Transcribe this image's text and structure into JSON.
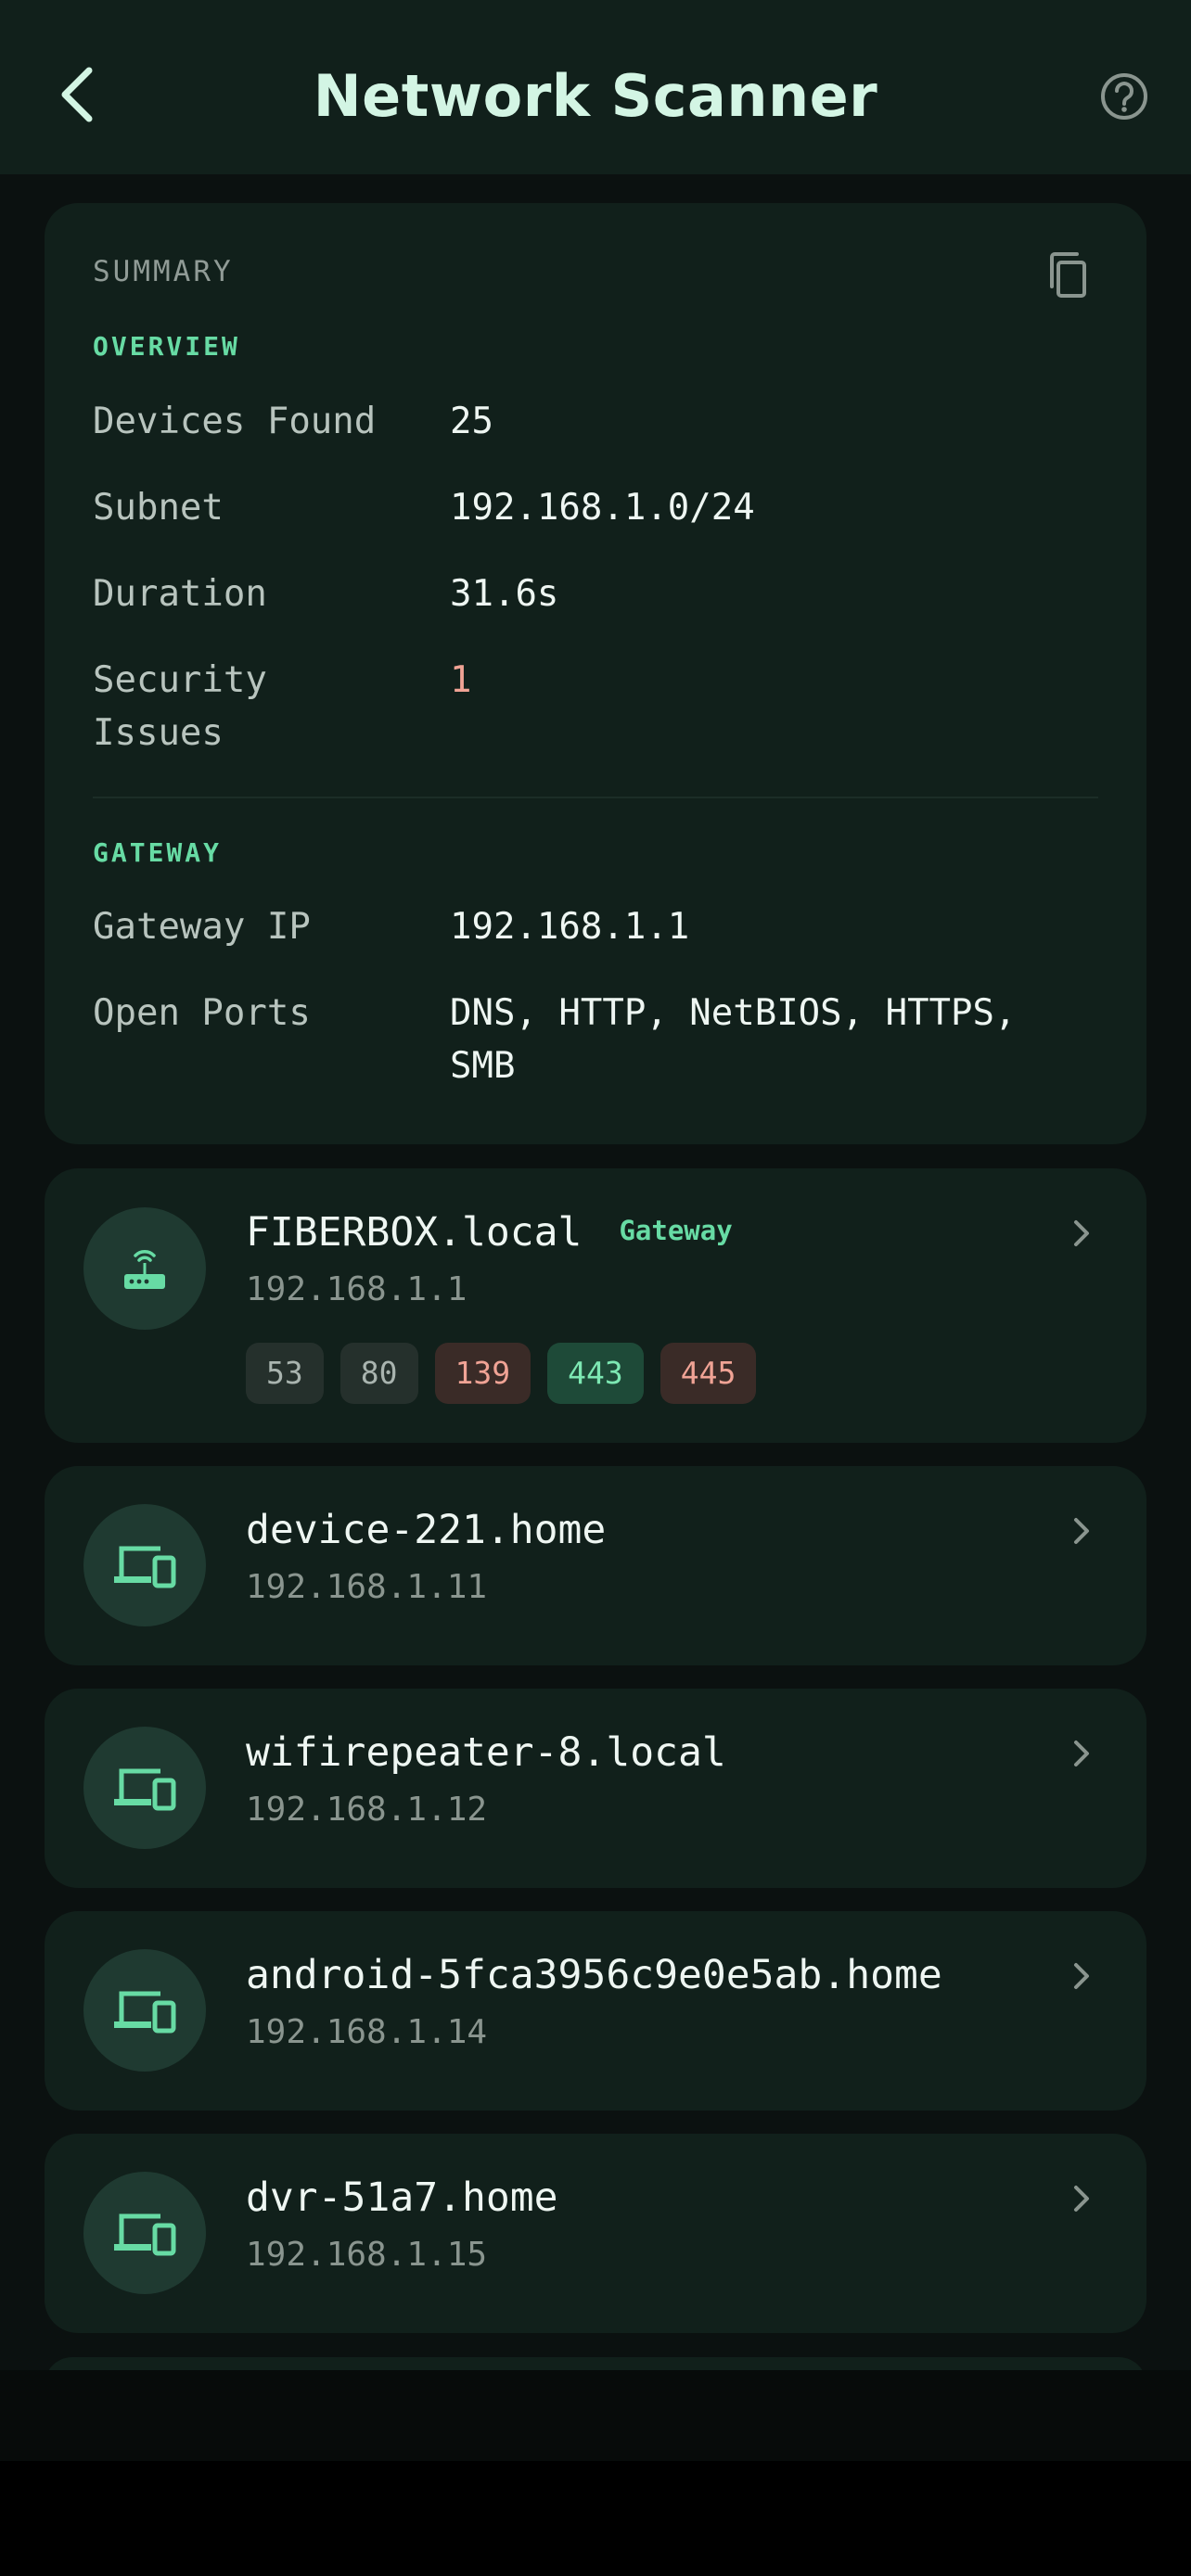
{
  "app_bar": {
    "title": "Network Scanner",
    "back_icon": "back-arrow-icon",
    "help_icon": "help-circle-icon"
  },
  "summary": {
    "heading": "SUMMARY",
    "copy_icon": "copy-icon",
    "overview": {
      "label": "OVERVIEW",
      "rows": [
        {
          "label": "Devices Found",
          "value": "25"
        },
        {
          "label": "Subnet",
          "value": "192.168.1.0/24"
        },
        {
          "label": "Duration",
          "value": "31.6s"
        },
        {
          "label": "Security Issues",
          "value": "1"
        }
      ]
    },
    "gateway": {
      "label": "GATEWAY",
      "rows": [
        {
          "label": "Gateway IP",
          "value": "192.168.1.1"
        },
        {
          "label": "Open Ports",
          "value": "DNS, HTTP, NetBIOS, HTTPS, SMB"
        }
      ]
    }
  },
  "devices": [
    {
      "name": "FIBERBOX.local",
      "badge": "Gateway",
      "ip": "192.168.1.1",
      "icon": "router-icon",
      "ports": [
        "53",
        "80",
        "139",
        "443",
        "445"
      ]
    },
    {
      "name": "device-221.home",
      "ip": "192.168.1.11",
      "icon": "devices-icon"
    },
    {
      "name": "wifirepeater-8.local",
      "ip": "192.168.1.12",
      "icon": "devices-icon"
    },
    {
      "name": "android-5fca3956c9e0e5ab.home",
      "ip": "192.168.1.14",
      "icon": "devices-icon"
    },
    {
      "name": "dvr-51a7.home",
      "ip": "192.168.1.15",
      "icon": "devices-icon"
    }
  ],
  "colors": {
    "accent": "#67dba4",
    "background": "#0b1110",
    "card": "#11201b",
    "alert": "#f0a395"
  }
}
